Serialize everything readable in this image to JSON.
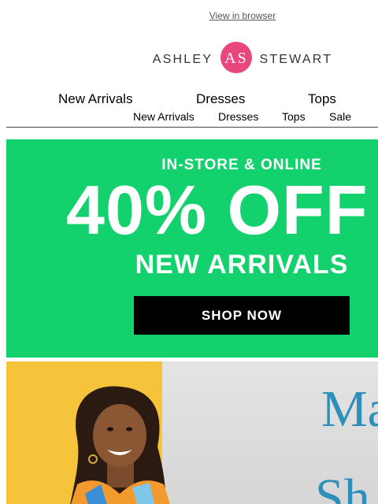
{
  "header": {
    "view_in_browser": "View in browser",
    "logo_left": "ASHLEY",
    "logo_right": "STEWART",
    "logo_monogram": "AS"
  },
  "nav": {
    "main": [
      "New Arrivals",
      "Dresses",
      "Tops"
    ],
    "sub": [
      "New Arrivals",
      "Dresses",
      "Tops",
      "Sale"
    ]
  },
  "promo": {
    "kicker": "IN-STORE & ONLINE",
    "headline": "40% OFF",
    "subhead": "NEW ARRIVALS",
    "cta": "SHOP NOW"
  },
  "hero": {
    "script_line1": "Ma",
    "script_line2": "Sh"
  },
  "colors": {
    "promo_green": "#13d26e",
    "brand_pink": "#e8467c",
    "hero_yellow": "#f6c43a",
    "script_blue": "#2e8fb8"
  }
}
